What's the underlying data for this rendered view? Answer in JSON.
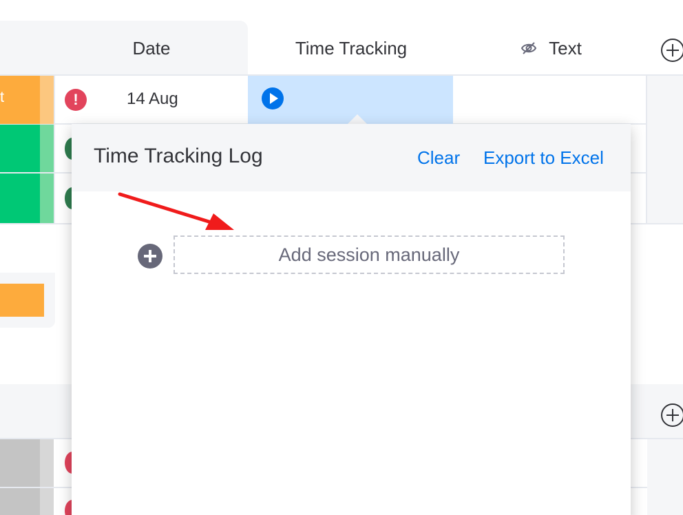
{
  "header": {
    "date_label": "Date",
    "time_tracking_label": "Time Tracking",
    "text_label": "Text"
  },
  "row1": {
    "status_fragment": "t",
    "date": "14 Aug",
    "alert_symbol": "!"
  },
  "popup": {
    "title": "Time Tracking Log",
    "clear_label": "Clear",
    "export_label": "Export to Excel",
    "add_session_label": "Add session manually"
  },
  "icons": {
    "eye": "eye-slash-icon",
    "add_column": "plus-circle-icon",
    "play": "play-icon",
    "alert": "exclamation-icon",
    "add_session": "plus-circle-filled-icon",
    "arrow": "red-arrow-annotation"
  },
  "colors": {
    "accent": "#0073ea",
    "status_orange": "#fdab3d",
    "status_green": "#00c875",
    "alert_red": "#e2445c",
    "selected_cell": "#cce5ff",
    "annotation_arrow": "#f01b1b"
  }
}
